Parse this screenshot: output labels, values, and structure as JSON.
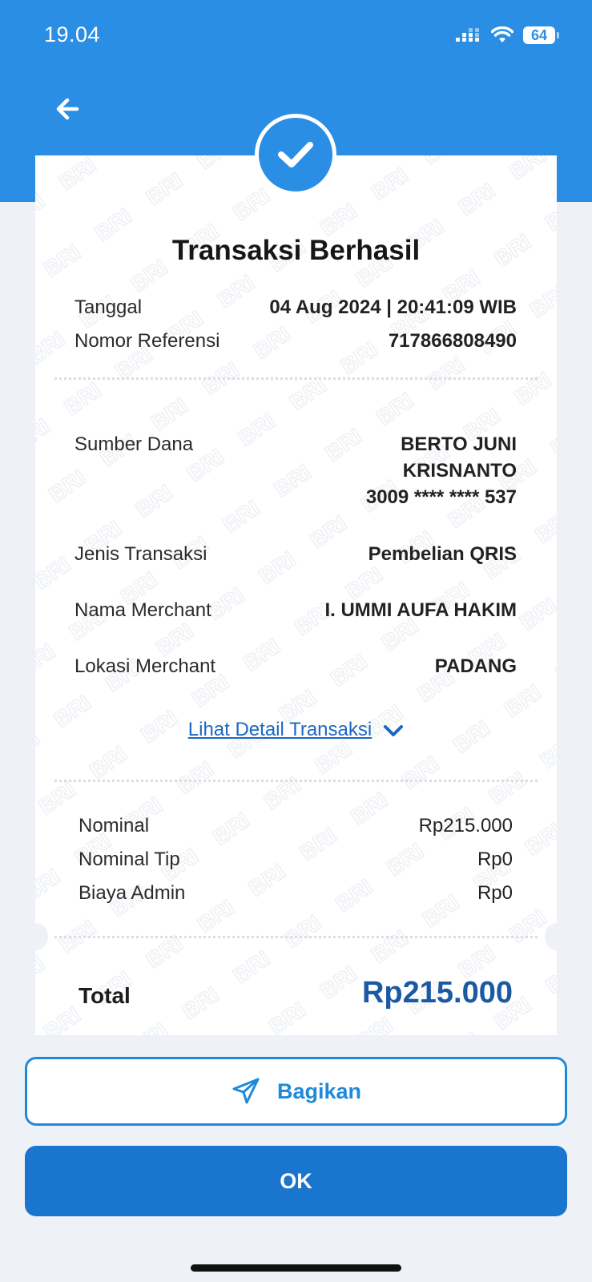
{
  "status_bar": {
    "time": "19.04",
    "battery": "64"
  },
  "receipt": {
    "watermark_text": "BRI",
    "title": "Transaksi Berhasil",
    "date_label": "Tanggal",
    "date_value": "04 Aug 2024 | 20:41:09 WIB",
    "ref_label": "Nomor Referensi",
    "ref_value": "717866808490",
    "source_label": "Sumber Dana",
    "source_name_1": "BERTO JUNI",
    "source_name_2": "KRISNANTO",
    "source_account": "3009 **** **** 537",
    "type_label": "Jenis Transaksi",
    "type_value": "Pembelian QRIS",
    "merchant_label": "Nama Merchant",
    "merchant_value": "I. UMMI AUFA HAKIM",
    "location_label": "Lokasi Merchant",
    "location_value": "PADANG",
    "detail_link": "Lihat Detail Transaksi",
    "nominal_label": "Nominal",
    "nominal_value": "Rp215.000",
    "tip_label": "Nominal Tip",
    "tip_value": "Rp0",
    "admin_label": "Biaya Admin",
    "admin_value": "Rp0",
    "total_label": "Total",
    "total_value": "Rp215.000"
  },
  "buttons": {
    "share": "Bagikan",
    "ok": "OK"
  },
  "colors": {
    "header": "#2a8ee4",
    "total": "#1a5aa3",
    "ok_button": "#1a75ce",
    "link": "#1c67c4"
  },
  "icons": [
    "back-arrow-icon",
    "checkmark-icon",
    "send-icon",
    "chevron-down-icon",
    "wifi-icon",
    "signal-icon"
  ]
}
